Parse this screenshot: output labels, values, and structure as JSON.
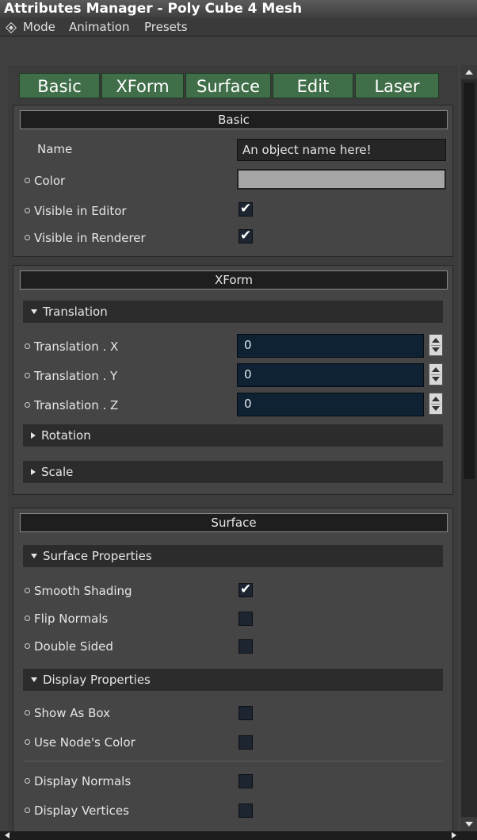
{
  "window": {
    "title": "Attributes Manager - Poly Cube 4 Mesh",
    "menu": [
      "Mode",
      "Animation",
      "Presets"
    ]
  },
  "tabs": [
    "Basic",
    "XForm",
    "Surface",
    "Edit",
    "Laser"
  ],
  "basic": {
    "header": "Basic",
    "name_label": "Name",
    "name_value": "An object name here!",
    "color_label": "Color",
    "color_value": "#a5a5a5",
    "visible_editor_label": "Visible in Editor",
    "visible_editor_checked": true,
    "visible_renderer_label": "Visible in Renderer",
    "visible_renderer_checked": true
  },
  "xform": {
    "header": "XForm",
    "translation_header": "Translation",
    "tx_label": "Translation . X",
    "tx_value": "0",
    "ty_label": "Translation . Y",
    "ty_value": "0",
    "tz_label": "Translation . Z",
    "tz_value": "0",
    "rotation_header": "Rotation",
    "scale_header": "Scale"
  },
  "surface": {
    "header": "Surface",
    "props_header": "Surface Properties",
    "smooth_label": "Smooth Shading",
    "smooth_checked": true,
    "flip_label": "Flip Normals",
    "flip_checked": false,
    "double_label": "Double Sided",
    "double_checked": false,
    "display_header": "Display Properties",
    "showbox_label": "Show As Box",
    "showbox_checked": false,
    "nodecolor_label": "Use Node's Color",
    "nodecolor_checked": false,
    "dispnormals_label": "Display Normals",
    "dispnormals_checked": false,
    "dispvertices_label": "Display Vertices",
    "dispvertices_checked": false
  },
  "icons": {
    "menu_mode": "diamond-icon",
    "checkmark": "✔"
  }
}
